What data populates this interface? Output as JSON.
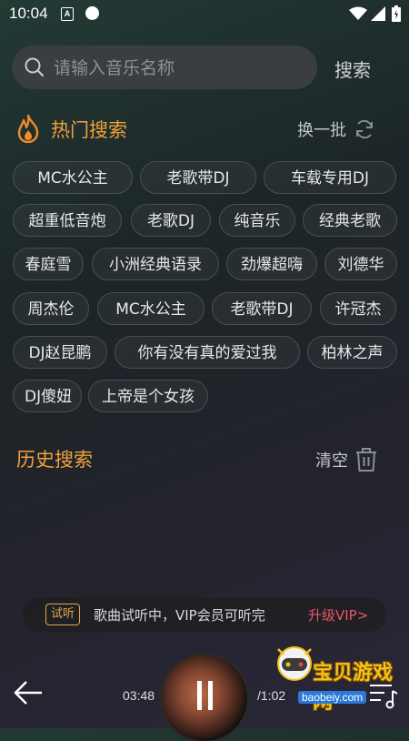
{
  "status_bar": {
    "time": "10:04",
    "notification_letter": "A"
  },
  "search": {
    "placeholder": "请输入音乐名称",
    "button_label": "搜索"
  },
  "hot": {
    "title": "热门搜索",
    "refresh_label": "换一批",
    "tags": [
      "MC水公主",
      "老歌带DJ",
      "车载专用DJ",
      "超重低音炮",
      "老歌DJ",
      "纯音乐",
      "经典老歌",
      "春庭雪",
      "小洲经典语录",
      "劲爆超嗨",
      "刘德华",
      "周杰伦",
      "MC水公主",
      "老歌带DJ",
      "许冠杰",
      "DJ赵昆鹏",
      "你有没有真的爱过我",
      "柏林之声",
      "DJ傻妞",
      "上帝是个女孩"
    ]
  },
  "history": {
    "title": "历史搜索",
    "clear_label": "清空"
  },
  "vip_banner": {
    "badge": "试听",
    "text": "歌曲试听中，VIP会员可听完",
    "upgrade": "升级VIP>"
  },
  "player": {
    "current_time": "03:48",
    "total_time": "/1:02"
  },
  "watermark": {
    "text": "宝贝游戏网",
    "url": "baobeiy.com"
  },
  "colors": {
    "accent": "#f0a23a",
    "vip_red": "#f0556a",
    "tag_border": "#4a4f53"
  }
}
